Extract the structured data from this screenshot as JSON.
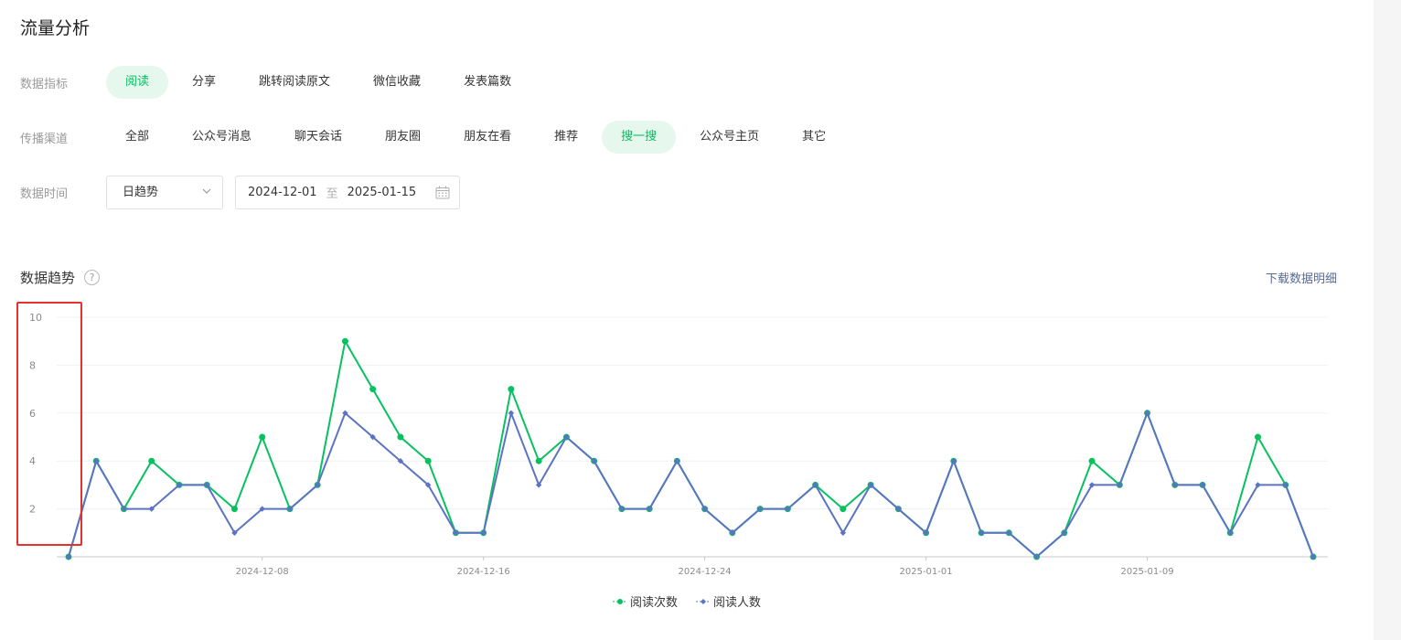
{
  "page": {
    "title": "流量分析"
  },
  "filters": {
    "metric": {
      "label": "数据指标",
      "options": [
        "阅读",
        "分享",
        "跳转阅读原文",
        "微信收藏",
        "发表篇数"
      ],
      "active": 0
    },
    "channel": {
      "label": "传播渠道",
      "options": [
        "全部",
        "公众号消息",
        "聊天会话",
        "朋友圈",
        "朋友在看",
        "推荐",
        "搜一搜",
        "公众号主页",
        "其它"
      ],
      "active": 6
    },
    "time": {
      "label": "数据时间",
      "granularity": "日趋势",
      "start": "2024-12-01",
      "separator": "至",
      "end": "2025-01-15"
    }
  },
  "trend": {
    "title": "数据趋势",
    "help_symbol": "?",
    "download_label": "下载数据明细"
  },
  "colors": {
    "accent": "#07c160",
    "series_reads": "#07c160",
    "series_readers": "#5b73c2",
    "link": "#576b95",
    "highlight": "#e8312e"
  },
  "chart_data": {
    "type": "line",
    "x": [
      "2024-12-01",
      "2024-12-02",
      "2024-12-03",
      "2024-12-04",
      "2024-12-05",
      "2024-12-06",
      "2024-12-07",
      "2024-12-08",
      "2024-12-09",
      "2024-12-10",
      "2024-12-11",
      "2024-12-12",
      "2024-12-13",
      "2024-12-14",
      "2024-12-15",
      "2024-12-16",
      "2024-12-17",
      "2024-12-18",
      "2024-12-19",
      "2024-12-20",
      "2024-12-21",
      "2024-12-22",
      "2024-12-23",
      "2024-12-24",
      "2024-12-25",
      "2024-12-26",
      "2024-12-27",
      "2024-12-28",
      "2024-12-29",
      "2024-12-30",
      "2024-12-31",
      "2025-01-01",
      "2025-01-02",
      "2025-01-03",
      "2025-01-04",
      "2025-01-05",
      "2025-01-06",
      "2025-01-07",
      "2025-01-08",
      "2025-01-09",
      "2025-01-10",
      "2025-01-11",
      "2025-01-12",
      "2025-01-13",
      "2025-01-14",
      "2025-01-15"
    ],
    "x_ticks": [
      "2024-12-08",
      "2024-12-16",
      "2024-12-24",
      "2025-01-01",
      "2025-01-09"
    ],
    "y_ticks": [
      2,
      4,
      6,
      8,
      10
    ],
    "ylim": [
      0,
      10
    ],
    "grid": true,
    "legend": "bottom",
    "series": [
      {
        "name": "阅读次数",
        "values": [
          0,
          4,
          2,
          4,
          3,
          3,
          2,
          5,
          2,
          3,
          9,
          7,
          5,
          4,
          1,
          1,
          7,
          4,
          5,
          4,
          2,
          2,
          4,
          2,
          1,
          2,
          2,
          3,
          2,
          3,
          2,
          1,
          4,
          1,
          1,
          0,
          1,
          4,
          3,
          6,
          3,
          3,
          1,
          5,
          3,
          0
        ]
      },
      {
        "name": "阅读人数",
        "values": [
          0,
          4,
          2,
          2,
          3,
          3,
          1,
          2,
          2,
          3,
          6,
          5,
          4,
          3,
          1,
          1,
          6,
          3,
          5,
          4,
          2,
          2,
          4,
          2,
          1,
          2,
          2,
          3,
          1,
          3,
          2,
          1,
          4,
          1,
          1,
          0,
          1,
          3,
          3,
          6,
          3,
          3,
          1,
          3,
          3,
          0
        ]
      }
    ]
  }
}
